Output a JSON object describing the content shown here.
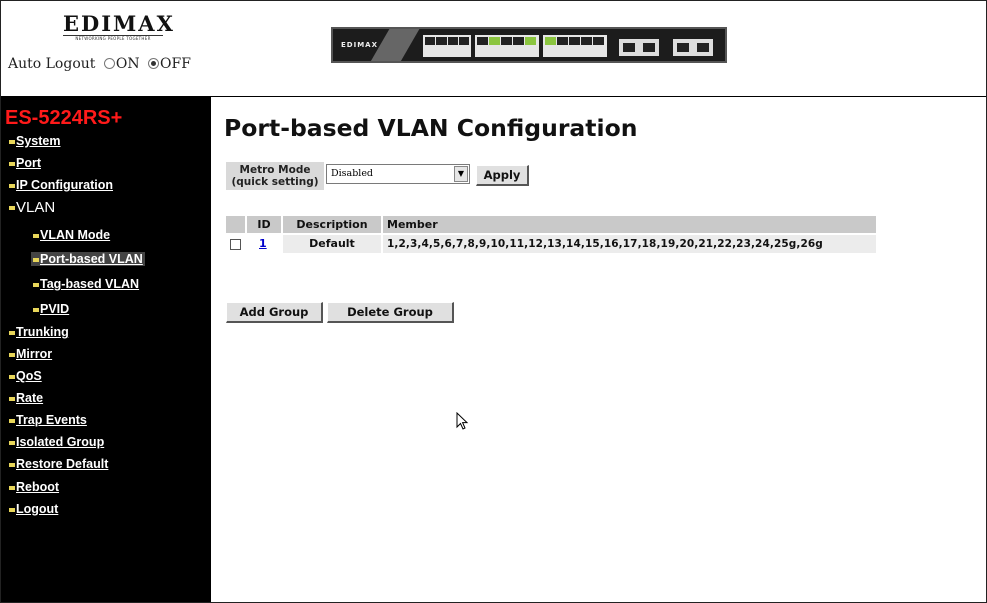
{
  "header": {
    "logo": "EDIMAX",
    "logo_tagline": "NETWORKING PEOPLE TOGETHER",
    "auto_logout_label": "Auto Logout",
    "auto_logout_on": "ON",
    "auto_logout_off": "OFF",
    "auto_logout_selected": "OFF",
    "device_brand": "EDIMAX"
  },
  "sidebar": {
    "model": "ES-5224RS+",
    "items": [
      {
        "label": "System"
      },
      {
        "label": "Port"
      },
      {
        "label": "IP Configuration"
      },
      {
        "label": "VLAN"
      },
      {
        "label": "VLAN Mode"
      },
      {
        "label": "Port-based VLAN"
      },
      {
        "label": "Tag-based VLAN"
      },
      {
        "label": "PVID"
      },
      {
        "label": "Trunking"
      },
      {
        "label": "Mirror"
      },
      {
        "label": "QoS"
      },
      {
        "label": "Rate"
      },
      {
        "label": "Trap Events"
      },
      {
        "label": "Isolated Group"
      },
      {
        "label": "Restore Default"
      },
      {
        "label": "Reboot"
      },
      {
        "label": "Logout"
      }
    ],
    "active": "Port-based VLAN"
  },
  "main": {
    "title": "Port-based VLAN Configuration",
    "metro_mode_label_line1": "Metro Mode",
    "metro_mode_label_line2": "(quick setting)",
    "metro_mode_value": "Disabled",
    "apply_label": "Apply",
    "table": {
      "headers": [
        "",
        "ID",
        "Description",
        "Member"
      ],
      "rows": [
        {
          "checked": false,
          "id": "1",
          "description": "Default",
          "member": "1,2,3,4,5,6,7,8,9,10,11,12,13,14,15,16,17,18,19,20,21,22,23,24,25g,26g"
        }
      ]
    },
    "add_group_label": "Add Group",
    "delete_group_label": "Delete Group"
  },
  "colors": {
    "sidebar_bg": "#000000",
    "model_color": "#ff1a1a",
    "bullet_color": "#e8d65a",
    "link_color": "#0000cc",
    "header_cell_bg": "#c9c9c9"
  }
}
